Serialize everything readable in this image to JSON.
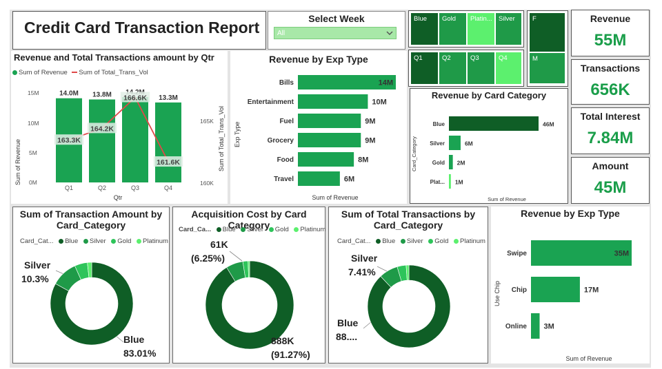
{
  "report_title": "Credit Card Transaction Report",
  "week_slicer": {
    "title": "Select Week",
    "value": "All"
  },
  "card_slicer": {
    "options": [
      "Blue",
      "Gold",
      "Platin...",
      "Silver"
    ]
  },
  "qtr_slicer": {
    "options": [
      "Q1",
      "Q2",
      "Q3",
      "Q4"
    ]
  },
  "gender_slicer": {
    "options": [
      "F",
      "M"
    ]
  },
  "kpis": {
    "revenue": {
      "label": "Revenue",
      "value": "55M"
    },
    "transactions": {
      "label": "Transactions",
      "value": "656K"
    },
    "interest": {
      "label": "Total Interest",
      "value": "7.84M"
    },
    "amount": {
      "label": "Amount",
      "value": "45M"
    }
  },
  "qtr_chart": {
    "title": "Revenue and Total Transactions amount by Qtr",
    "legend": [
      "Sum of Revenue",
      "Sum of Total_Trans_Vol"
    ],
    "xlabel": "Qtr",
    "ylabel_left": "Sum of Revenue",
    "ylabel_right": "Sum of Total_Trans_Vol",
    "left_ticks": [
      "15M",
      "10M",
      "5M",
      "0M"
    ],
    "right_ticks": [
      "165K",
      "160K"
    ],
    "categories": [
      "Q1",
      "Q2",
      "Q3",
      "Q4"
    ],
    "bar_labels": [
      "14.0M",
      "13.8M",
      "14.2M",
      "13.3M"
    ],
    "line_labels": [
      "163.3K",
      "164.2K",
      "166.6K",
      "161.6K"
    ]
  },
  "exp_chart": {
    "title": "Revenue by Exp Type",
    "ylabel": "Exp Type",
    "xlabel": "Sum of Revenue",
    "categories": [
      "Bills",
      "Entertainment",
      "Fuel",
      "Grocery",
      "Food",
      "Travel"
    ],
    "labels": [
      "14M",
      "10M",
      "9M",
      "9M",
      "8M",
      "6M"
    ]
  },
  "card_cat_chart": {
    "title": "Revenue by Card Category",
    "ylabel": "Card_Category",
    "xlabel": "Sum of Revenue",
    "categories": [
      "Blue",
      "Silver",
      "Gold",
      "Plat..."
    ],
    "labels": [
      "46M",
      "6M",
      "2M",
      "1M"
    ]
  },
  "donut1": {
    "title_line1": "Sum of Transaction Amount by",
    "title_line2": "Card_Category",
    "legend_title": "Card_Cat...",
    "legend": [
      "Blue",
      "Silver",
      "Gold",
      "Platinum"
    ],
    "silver_label": "Silver",
    "silver_pct": "10.3%",
    "blue_label": "Blue",
    "blue_pct": "83.01%"
  },
  "donut2": {
    "title": "Acquisition Cost by Card Category",
    "legend_title": "Card_Ca...",
    "legend": [
      "Blue",
      "Silver",
      "Gold",
      "Platinum"
    ],
    "silver_val": "61K",
    "silver_pct": "(6.25%)",
    "blue_val": "888K",
    "blue_pct": "(91.27%)"
  },
  "donut3": {
    "title_line1": "Sum of Total Transactions by",
    "title_line2": "Card_Category",
    "legend_title": "Card_Cat...",
    "legend": [
      "Blue",
      "Silver",
      "Gold",
      "Platinum"
    ],
    "silver_label": "Silver",
    "silver_pct": "7.41%",
    "blue_label": "Blue",
    "blue_pct": "88...."
  },
  "chip_chart": {
    "title": "Revenue by Exp Type",
    "ylabel": "Use Chip",
    "xlabel": "Sum of Revenue",
    "categories": [
      "Swipe",
      "Chip",
      "Online"
    ],
    "labels": [
      "35M",
      "17M",
      "3M"
    ]
  },
  "chart_data": [
    {
      "type": "bar",
      "title": "Revenue and Total Transactions amount by Qtr",
      "categories": [
        "Q1",
        "Q2",
        "Q3",
        "Q4"
      ],
      "series": [
        {
          "name": "Sum of Revenue",
          "values": [
            14.0,
            13.8,
            14.2,
            13.3
          ],
          "unit": "M"
        },
        {
          "name": "Sum of Total_Trans_Vol",
          "values": [
            163.3,
            164.2,
            166.6,
            161.6
          ],
          "unit": "K"
        }
      ],
      "ylim_left": [
        0,
        15
      ],
      "ylim_right": [
        160,
        167
      ]
    },
    {
      "type": "bar",
      "title": "Revenue by Exp Type",
      "categories": [
        "Bills",
        "Entertainment",
        "Fuel",
        "Grocery",
        "Food",
        "Travel"
      ],
      "values": [
        14,
        10,
        9,
        9,
        8,
        6
      ]
    },
    {
      "type": "bar",
      "title": "Revenue by Card Category",
      "categories": [
        "Blue",
        "Silver",
        "Gold",
        "Plat..."
      ],
      "values": [
        46,
        6,
        2,
        1
      ]
    },
    {
      "type": "pie",
      "title": "Sum of Transaction Amount by Card_Category",
      "categories": [
        "Blue",
        "Silver",
        "Gold",
        "Platinum"
      ],
      "values": [
        83.01,
        10.3,
        5.0,
        1.69
      ]
    },
    {
      "type": "pie",
      "title": "Acquisition Cost by Card Category",
      "categories": [
        "Blue",
        "Silver",
        "Gold",
        "Platinum"
      ],
      "values": [
        91.27,
        6.25,
        1.9,
        0.58
      ]
    },
    {
      "type": "pie",
      "title": "Sum of Total Transactions by Card_Category",
      "categories": [
        "Blue",
        "Silver",
        "Gold",
        "Platinum"
      ],
      "values": [
        88.0,
        7.41,
        3.5,
        1.09
      ]
    },
    {
      "type": "bar",
      "title": "Revenue by Exp Type",
      "categories": [
        "Swipe",
        "Chip",
        "Online"
      ],
      "values": [
        35,
        17,
        3
      ]
    }
  ],
  "colors": {
    "blue_series": "#0f5e26",
    "silver_series": "#1f9a48",
    "gold_series": "#2ec45a",
    "platinum_series": "#5cf06e",
    "bar": "#1aa352",
    "line": "#e04848",
    "kpi": "#1a9e4a"
  }
}
